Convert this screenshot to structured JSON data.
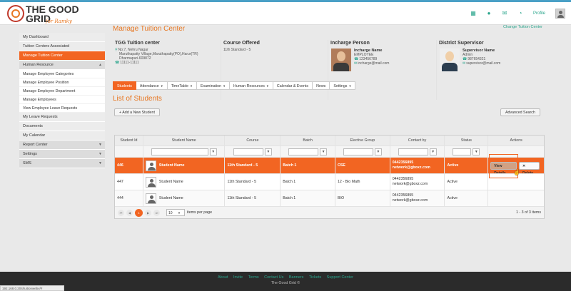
{
  "brand": {
    "line1": "THE GOOD",
    "line2": "GRID",
    "tagline": "for Ramky"
  },
  "header": {
    "profile_label": "Profile",
    "icons": [
      "apps-grid-icon",
      "users-icon",
      "mail-icon",
      "bell-icon"
    ]
  },
  "sidebar": {
    "items": [
      {
        "label": "My Dashboard"
      },
      {
        "label": "Tuition Centers Associated"
      },
      {
        "label": "Manage Tuition Center",
        "active": true
      }
    ],
    "section_hr": "Human Resource",
    "hr_items": [
      "Manage Employee Categories",
      "Manage Employee Position",
      "Manage Employee Department",
      "Manage Employees",
      "View Employee Leave Requests"
    ],
    "bottom_items": [
      "My Leave Requests",
      "Documents",
      "My Calendar"
    ],
    "sections": [
      "Report Center",
      "Settings",
      "SMS"
    ]
  },
  "page": {
    "title": "Manage Tuition Center",
    "change_link": "Change Tuition Center",
    "list_title": "List of Students"
  },
  "center": {
    "title": "TGG Tuition center",
    "address1": "No:7, Nehru Nagar",
    "address2": "Maruthapatty Village,Maruthapatty(PO),Harur(TR)",
    "address3": "Dharmapuri-609872",
    "phone": "11111-11111"
  },
  "course": {
    "title": "Course Offered",
    "value": "11th Standard - 5"
  },
  "incharge": {
    "title": "Incharge Person",
    "name": "Incharge Name",
    "role": "EMPLOYEE",
    "phone": "123456789",
    "email": "incharge@mail.com"
  },
  "supervisor": {
    "title": "District Supervisor",
    "name": "Supervisor Name",
    "role": "Admin",
    "phone": "987654321",
    "email": "supervisor@mail.com"
  },
  "tabs": [
    {
      "label": "Students",
      "active": true,
      "caret": false
    },
    {
      "label": "Attendance",
      "caret": true
    },
    {
      "label": "TimeTable",
      "caret": true
    },
    {
      "label": "Examination",
      "caret": true
    },
    {
      "label": "Human Resources",
      "caret": true
    },
    {
      "label": "Calendar & Events",
      "caret": false
    },
    {
      "label": "News",
      "caret": false
    },
    {
      "label": "Settings",
      "caret": true
    }
  ],
  "buttons": {
    "add_student": "+ Add a New Student",
    "advanced_search": "Advanced Search",
    "view_details": "View Details",
    "delete": "✕ Delete"
  },
  "grid": {
    "columns": [
      "Student Id",
      "Student Name",
      "Course",
      "Batch",
      "Elective Group",
      "Contact by",
      "Status",
      "Actions"
    ],
    "rows": [
      {
        "id": "446",
        "name": "Student Name",
        "course": "11th Standard - 5",
        "batch": "Batch 1",
        "elective": "CSE",
        "phone": "0442356895",
        "email": "network@gboxz.com",
        "status": "Active",
        "selected": true
      },
      {
        "id": "447",
        "name": "Student Name",
        "course": "11th Standard - 5",
        "batch": "Batch 1",
        "elective": "12 - Bio Math",
        "phone": "0442356895",
        "email": "network@gboxz.com",
        "status": "Active"
      },
      {
        "id": "444",
        "name": "Student Name",
        "course": "11th Standard - 5",
        "batch": "Batch 1",
        "elective": "BIO",
        "phone": "0442356895",
        "email": "network@gboxz.com",
        "status": "Active"
      }
    ]
  },
  "pager": {
    "current": "1",
    "page_size": "10",
    "per_page_label": "items per page",
    "info": "1 - 3 of 3 items"
  },
  "footer": {
    "links": [
      "About",
      "Invite",
      "Terms",
      "Contact Us",
      "Banners",
      "Tickets",
      "Support Center"
    ],
    "copyright": "The Good Grid ©"
  },
  "status_url": "192.168.0.204/tuitionwebv/#"
}
